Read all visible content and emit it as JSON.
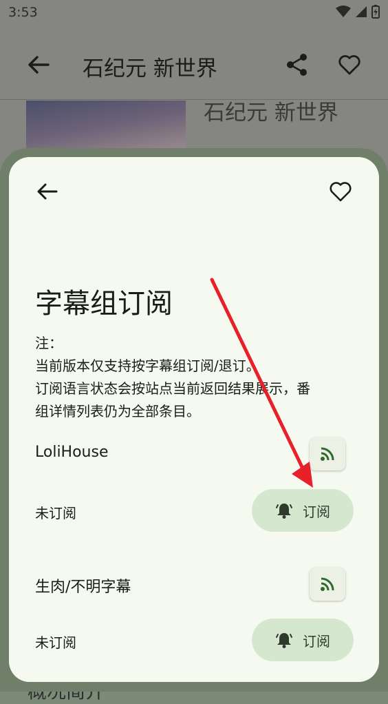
{
  "status_bar": {
    "time": "3:53"
  },
  "app_bar": {
    "title": "石纪元 新世界"
  },
  "background": {
    "title": "石纪元 新世界",
    "bottom_text": "概况简介"
  },
  "dialog": {
    "title": "字幕组订阅",
    "note_lines": [
      "注：",
      "当前版本仅支持按字幕组订阅/退订。",
      "订阅语言状态会按站点当前返回结果展示，番",
      "组详情列表仍为全部条目。"
    ],
    "groups": [
      {
        "name": "LoliHouse",
        "status": "未订阅",
        "button_label": "订阅"
      },
      {
        "name": "生肉/不明字幕",
        "status": "未订阅",
        "button_label": "订阅"
      }
    ]
  },
  "colors": {
    "annotation_arrow": "#e8202a",
    "subscribe_button_bg": "#d5e8cf",
    "rss_icon": "#2e6b2a",
    "dialog_bg": "#f6f9ef"
  }
}
